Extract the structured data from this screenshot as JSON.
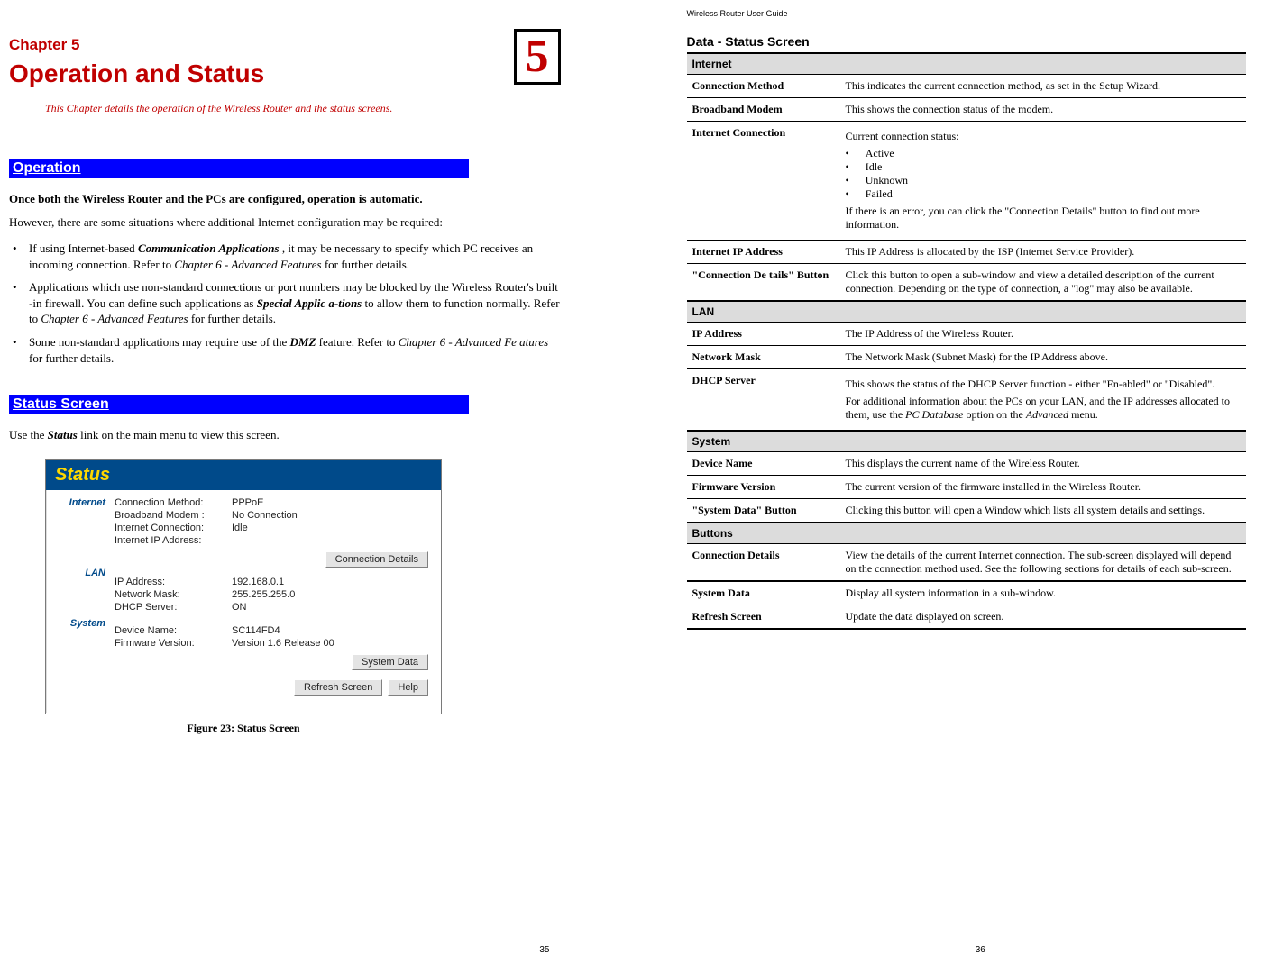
{
  "left": {
    "chapterLabel": "Chapter 5",
    "chapterTitle": "Operation and Status",
    "bigNumber": "5",
    "lead": "This Chapter details the operation of the Wireless Router and the status screens.",
    "section1": "Operation",
    "p1": "Once both the Wireless Router and the PCs are configured, operation is automatic.",
    "p2": "However, there are some situations where additional Internet configuration may be required:",
    "bullets": [
      {
        "pre": "If using Internet-based ",
        "em": "Communication Applications",
        "mid": " , it may be necessary to specify which PC receives an incoming connection. Refer to ",
        "em2": "Chapter 6 - Advanced Features",
        "post": " for further details."
      },
      {
        "pre": "Applications which use non-standard connections or port numbers may be blocked by the Wireless Router's built -in firewall. You can define such applications as ",
        "em": "Special Applic a-tions",
        "mid": " to allow them to function normally. Refer to ",
        "em2": "Chapter 6 - Advanced Features",
        "post": " for further details."
      },
      {
        "pre": "Some non-standard applications may require use of the ",
        "em": "DMZ",
        "mid": "  feature. Refer to ",
        "em2": "Chapter 6 - Advanced Fe atures",
        "post": " for further details."
      }
    ],
    "section2": "Status Screen",
    "p3a": "Use the ",
    "p3em": "Status",
    "p3b": "  link on the main menu to view this screen.",
    "shot": {
      "title": "Status",
      "sideTabs": {
        "internet": "Internet",
        "lan": "LAN",
        "system": "System"
      },
      "internet": [
        {
          "label": "Connection Method:",
          "value": "PPPoE"
        },
        {
          "label": "Broadband Modem :",
          "value": "No Connection"
        },
        {
          "label": "Internet Connection:",
          "value": "Idle"
        },
        {
          "label": "Internet IP Address:",
          "value": ""
        }
      ],
      "btnConn": "Connection Details",
      "lan": [
        {
          "label": "IP Address:",
          "value": "192.168.0.1"
        },
        {
          "label": "Network Mask:",
          "value": "255.255.255.0"
        },
        {
          "label": "DHCP Server:",
          "value": "ON"
        }
      ],
      "system": [
        {
          "label": "Device Name:",
          "value": "SC114FD4"
        },
        {
          "label": "Firmware Version:",
          "value": "Version 1.6 Release 00"
        }
      ],
      "btnSys": "System Data",
      "btnRefresh": "Refresh Screen",
      "btnHelp": "Help"
    },
    "figCaption": "Figure 23: Status Screen",
    "pageNum": "35"
  },
  "right": {
    "runningHeader": "Wireless Router User Guide",
    "h2": "Data - Status Screen",
    "rows": [
      {
        "k": "Connection Method",
        "v": "This indicates the current connection method, as set in the Setup Wizard."
      },
      {
        "k": "Broadband Modem",
        "v": "This shows the connection status of the modem."
      },
      {
        "k": "Internet Connection",
        "v": "SPECIAL_INTERNET_CONN"
      },
      {
        "k": "Internet IP Address",
        "v": "This IP Address is allocated by the ISP (Internet Service Provider)."
      },
      {
        "k": "\"Connection De tails\" Button",
        "v": "Click this button to open a sub-window and view a detailed description of the current connection. Depending on the type of connection, a \"log\" may also be available."
      }
    ],
    "internetConn": {
      "lead": "Current connection status:",
      "items": [
        "Active",
        "Idle",
        "Unknown",
        "Failed"
      ],
      "tail": "If there is an error, you can click the \"Connection Details\" button to find out more information."
    },
    "secInternet": "Internet",
    "secLAN": "LAN",
    "rowsLAN": [
      {
        "k": "IP Address",
        "v": "The IP Address of the Wireless Router."
      },
      {
        "k": "Network Mask",
        "v": "The Network Mask (Subnet Mask) for the IP Address above."
      },
      {
        "k": "DHCP Server",
        "v": "SPECIAL_DHCP"
      }
    ],
    "dhcp": {
      "p1": "This shows the status of the DHCP Server function - either \"En-abled\" or \"Disabled\".",
      "p2a": "For additional information about the PCs on your LAN, and the IP addresses allocated to them, use the ",
      "em": "PC Database",
      "p2b": " option on the ",
      "em2": "Advanced",
      "p2c": " menu."
    },
    "secSystem": "System",
    "rowsSystem": [
      {
        "k": "Device Name",
        "v": "This displays the current name of the Wireless Router."
      },
      {
        "k": "Firmware Version",
        "v": "The current version of the  firmware installed in the Wireless Router."
      },
      {
        "k": "\"System Data\" Button",
        "v": "Clicking this button will open a Window which lists all system details and settings."
      }
    ],
    "secButtons": "Buttons",
    "rowsButtons": [
      {
        "k": "Connection Details",
        "v": "View the details of the current Internet connection. The sub-screen displayed will depend on the connection method used. See the following sections for details of each sub-screen."
      },
      {
        "k": "System Data",
        "v": "Display all system information in a sub-window."
      },
      {
        "k": "Refresh Screen",
        "v": "Update the data displayed on screen."
      }
    ],
    "pageNum": "36"
  }
}
